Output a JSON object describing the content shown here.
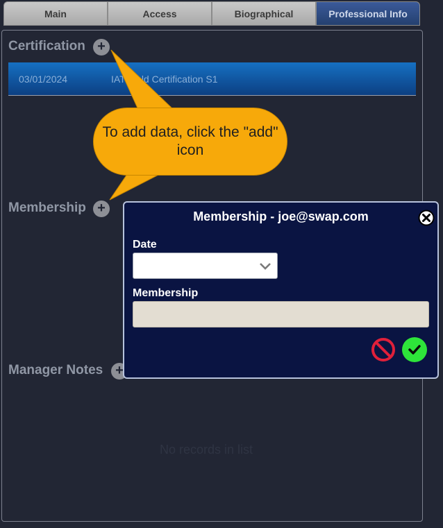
{
  "tabs": [
    {
      "label": "Main"
    },
    {
      "label": "Access"
    },
    {
      "label": "Biographical"
    },
    {
      "label": "Professional Info",
      "active": true
    }
  ],
  "sections": {
    "certification": {
      "title": "Certification",
      "rows": [
        {
          "date": "03/01/2024",
          "name": "IAT Field Certification S1"
        }
      ]
    },
    "membership": {
      "title": "Membership"
    },
    "manager_notes": {
      "title": "Manager Notes",
      "empty_message": "No records in list"
    }
  },
  "callout": {
    "text": "To add data, click the \"add\" icon"
  },
  "dialog": {
    "title": "Membership - joe@swap.com",
    "date_label": "Date",
    "date_value": "",
    "membership_label": "Membership",
    "membership_value": ""
  },
  "icons": {
    "add": "plus-icon",
    "close": "close-icon",
    "cancel": "cancel-icon",
    "confirm": "check-icon",
    "dropdown": "chevron-down-icon"
  },
  "colors": {
    "background": "#222634",
    "active_tab": "#2b4a82",
    "selected_row": "#1262b3",
    "callout": "#f7a90a",
    "dialog_bg": "#0a1442",
    "cancel": "#e0203a",
    "confirm": "#2ee43a"
  }
}
